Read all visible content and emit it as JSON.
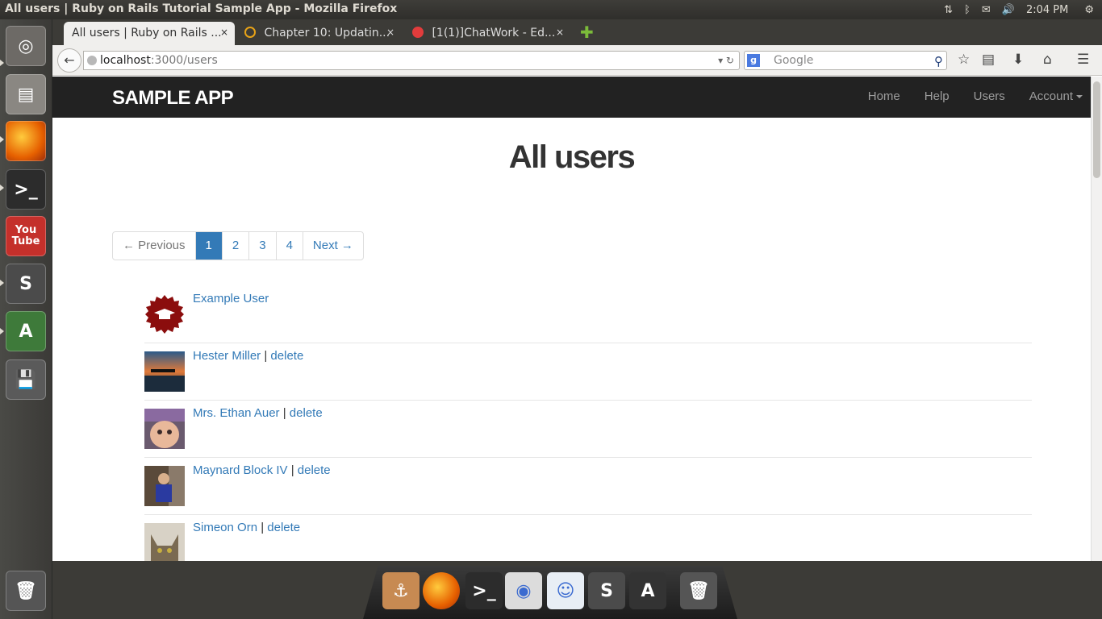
{
  "window": {
    "title": "All users | Ruby on Rails Tutorial Sample App - Mozilla Firefox"
  },
  "system_tray": {
    "network": "⇅",
    "bluetooth": "ᛒ",
    "mail": "✉",
    "volume": "🔊",
    "clock": "2:04 PM",
    "settings": "⚙"
  },
  "launcher": {
    "items": [
      {
        "name": "ubuntu-dash",
        "glyph": "◎",
        "color": "#6d6a66"
      },
      {
        "name": "files",
        "glyph": "▤",
        "color": "#8a8782"
      },
      {
        "name": "firefox",
        "glyph": "",
        "color": "#e66000"
      },
      {
        "name": "terminal",
        "glyph": ">_",
        "color": "#2c2c2c"
      },
      {
        "name": "youtube",
        "glyph": "You Tube",
        "color": "#c4302b"
      },
      {
        "name": "sublime-text",
        "glyph": "S",
        "color": "#4b4b4b"
      },
      {
        "name": "software-updater",
        "glyph": "A",
        "color": "#3e7a3a"
      },
      {
        "name": "save",
        "glyph": "💾",
        "color": "#5a5a5a"
      },
      {
        "name": "trash",
        "glyph": "🗑",
        "color": "#555"
      }
    ]
  },
  "tabs": [
    {
      "label": "All users | Ruby on Rails ...",
      "close": "×",
      "active": true
    },
    {
      "label": "Chapter 10: Updatin...",
      "close": "×",
      "active": false
    },
    {
      "label": "[1(1)]ChatWork - Ed...",
      "close": "×",
      "active": false
    }
  ],
  "new_tab_label": "✚",
  "toolbar": {
    "back": "←",
    "url_host": "localhost",
    "url_path": ":3000/users",
    "url_tools": "▾ ↻",
    "search_engine": "g",
    "search_placeholder": "Google",
    "search_go": "⚲",
    "icons": {
      "bookmark": "☆",
      "reader": "▤",
      "download": "⬇",
      "home": "⌂",
      "menu": "☰"
    }
  },
  "app": {
    "brand": "SAMPLE APP",
    "nav": {
      "home": "Home",
      "help": "Help",
      "users": "Users",
      "account": "Account"
    },
    "page_title": "All users",
    "pagination": {
      "prev": "← Previous",
      "pages": [
        "1",
        "2",
        "3",
        "4"
      ],
      "active_page": "1",
      "next": "Next →"
    },
    "users": [
      {
        "name": "Example User",
        "separator": "",
        "delete": ""
      },
      {
        "name": "Hester Miller",
        "separator": " | ",
        "delete": "delete"
      },
      {
        "name": "Mrs. Ethan Auer",
        "separator": " | ",
        "delete": "delete"
      },
      {
        "name": "Maynard Block IV",
        "separator": " | ",
        "delete": "delete"
      },
      {
        "name": "Simeon Orn",
        "separator": " | ",
        "delete": "delete"
      }
    ]
  },
  "dock": {
    "items": [
      {
        "name": "anchor",
        "glyph": "⚓",
        "color": "#c78a52"
      },
      {
        "name": "firefox",
        "glyph": "",
        "color": "#e66000"
      },
      {
        "name": "terminal",
        "glyph": ">_",
        "color": "#2c2c2c"
      },
      {
        "name": "speaker",
        "glyph": "◉",
        "color": "#dcdcdc"
      },
      {
        "name": "chat",
        "glyph": "☺",
        "color": "#e8eef5"
      },
      {
        "name": "sublime-text",
        "glyph": "S",
        "color": "#4b4b4b"
      },
      {
        "name": "software-updater",
        "glyph": "A",
        "color": "#333"
      },
      {
        "name": "trash",
        "glyph": "🗑",
        "color": "#555"
      }
    ]
  }
}
